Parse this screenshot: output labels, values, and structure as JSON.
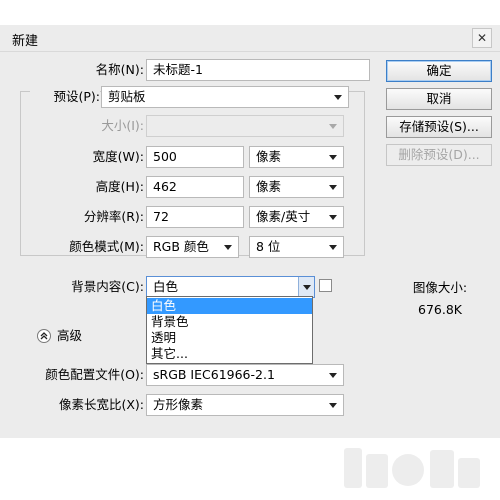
{
  "window": {
    "title": "新建",
    "close_label": "✕"
  },
  "form": {
    "name": {
      "label": "名称(N):",
      "value": "未标题-1"
    },
    "preset": {
      "label": "预设(P):",
      "value": "剪贴板"
    },
    "size": {
      "label": "大小(I):",
      "value": ""
    },
    "width": {
      "label": "宽度(W):",
      "value": "500",
      "unit": "像素"
    },
    "height": {
      "label": "高度(H):",
      "value": "462",
      "unit": "像素"
    },
    "resolution": {
      "label": "分辨率(R):",
      "value": "72",
      "unit": "像素/英寸"
    },
    "color_mode": {
      "label": "颜色模式(M):",
      "value": "RGB 颜色",
      "depth": "8 位"
    },
    "background": {
      "label": "背景内容(C):",
      "value": "白色",
      "options": [
        "白色",
        "背景色",
        "透明",
        "其它..."
      ]
    },
    "advanced": {
      "label": "高级"
    },
    "color_profile": {
      "label": "颜色配置文件(O):",
      "value": "sRGB IEC61966-2.1"
    },
    "pixel_aspect": {
      "label": "像素长宽比(X):",
      "value": "方形像素"
    }
  },
  "buttons": {
    "ok": "确定",
    "cancel": "取消",
    "save_preset": "存储预设(S)...",
    "delete_preset": "删除预设(D)..."
  },
  "image_size": {
    "label": "图像大小:",
    "value": "676.8K"
  },
  "colors": {
    "selection": "#3399ff",
    "focus_border": "#5a8fd6",
    "dialog_bg": "#ececec"
  }
}
